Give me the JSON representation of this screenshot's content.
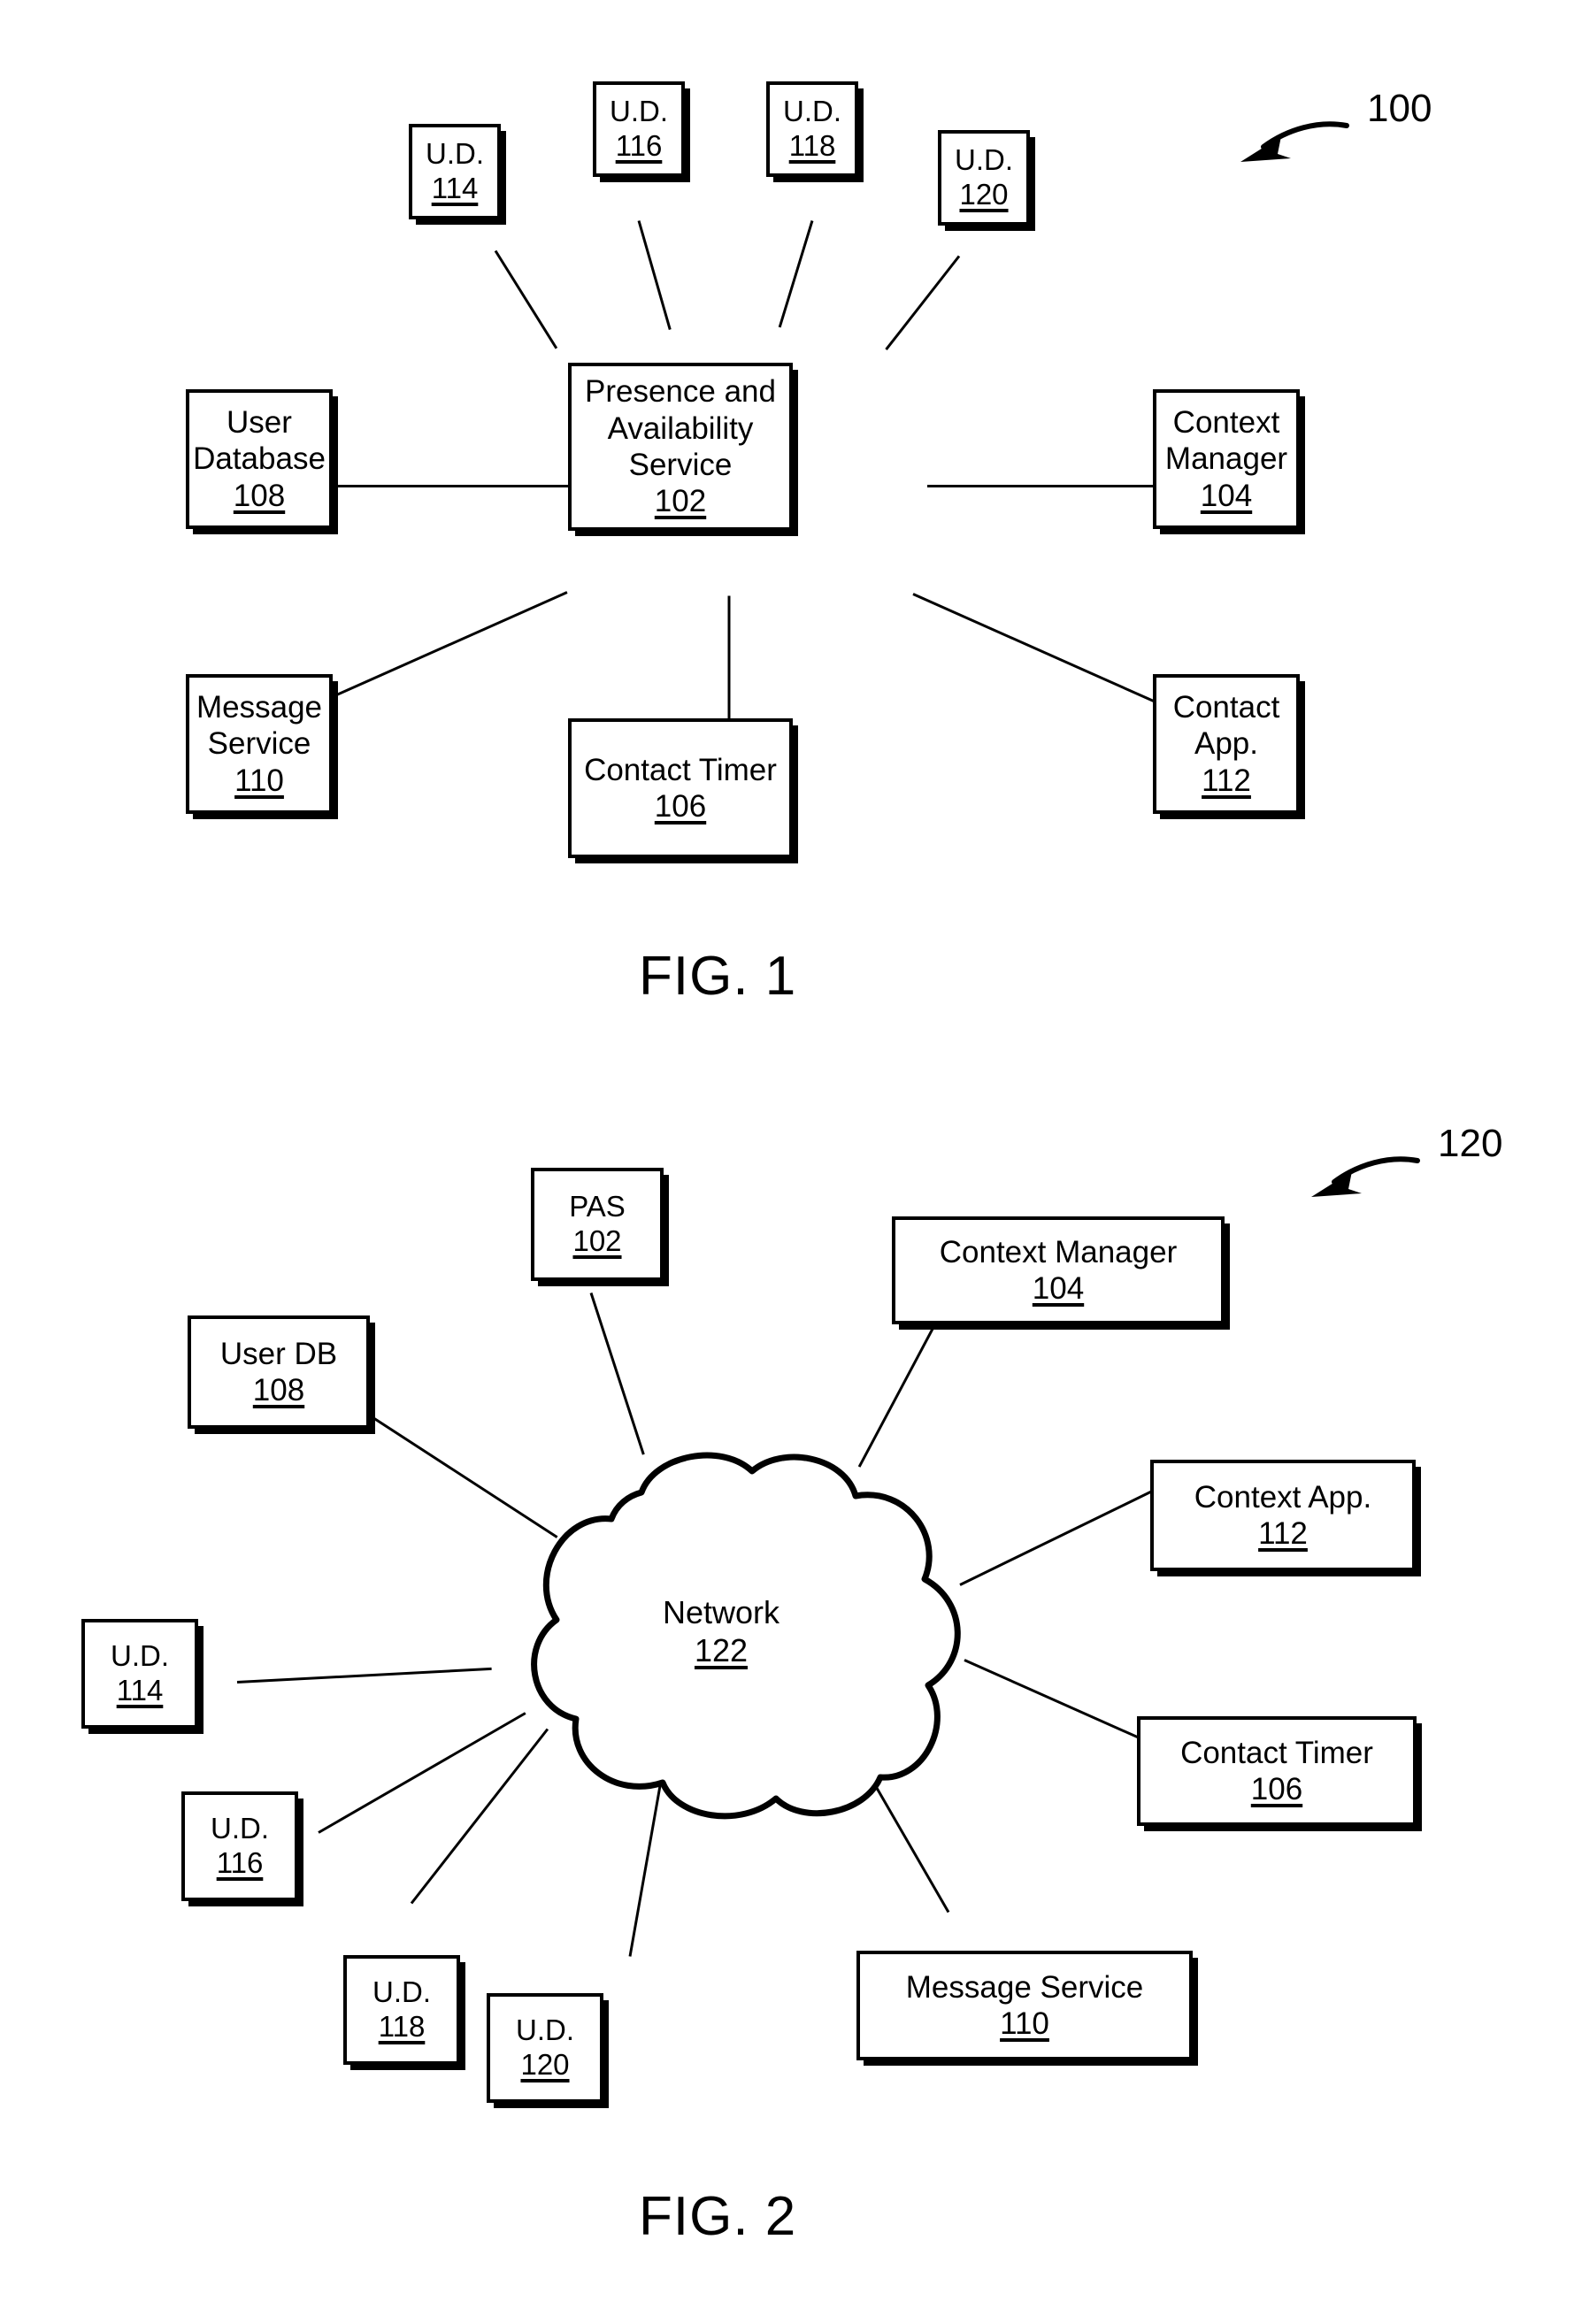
{
  "document": {
    "type": "patent-drawing-sheet",
    "background_color": "#ffffff",
    "line_color": "#000000"
  },
  "figure1": {
    "caption": "FIG. 1",
    "callout": {
      "number": "100"
    },
    "nodes": {
      "ud114": {
        "title": "U.D.",
        "ref": "114"
      },
      "ud116": {
        "title": "U.D.",
        "ref": "116"
      },
      "ud118": {
        "title": "U.D.",
        "ref": "118"
      },
      "ud120": {
        "title": "U.D.",
        "ref": "120"
      },
      "pas": {
        "title": "Presence and\nAvailability\nService",
        "ref": "102"
      },
      "userdb": {
        "title": "User\nDatabase",
        "ref": "108"
      },
      "ctxmgr": {
        "title": "Context\nManager",
        "ref": "104"
      },
      "msgsvc": {
        "title": "Message\nService",
        "ref": "110"
      },
      "timer": {
        "title": "Contact Timer",
        "ref": "106"
      },
      "ctxapp": {
        "title": "Contact\nApp.",
        "ref": "112"
      }
    }
  },
  "figure2": {
    "caption": "FIG. 2",
    "callout": {
      "number": "120"
    },
    "nodes": {
      "pas": {
        "title": "PAS",
        "ref": "102"
      },
      "ctxmgr": {
        "title": "Context Manager",
        "ref": "104"
      },
      "userdb": {
        "title": "User DB",
        "ref": "108"
      },
      "ctxapp": {
        "title": "Context App.",
        "ref": "112"
      },
      "ud114": {
        "title": "U.D.",
        "ref": "114"
      },
      "timer": {
        "title": "Contact Timer",
        "ref": "106"
      },
      "ud116": {
        "title": "U.D.",
        "ref": "116"
      },
      "ud118": {
        "title": "U.D.",
        "ref": "118"
      },
      "ud120": {
        "title": "U.D.",
        "ref": "120"
      },
      "msgsvc": {
        "title": "Message Service",
        "ref": "110"
      },
      "network": {
        "title": "Network",
        "ref": "122"
      }
    }
  }
}
